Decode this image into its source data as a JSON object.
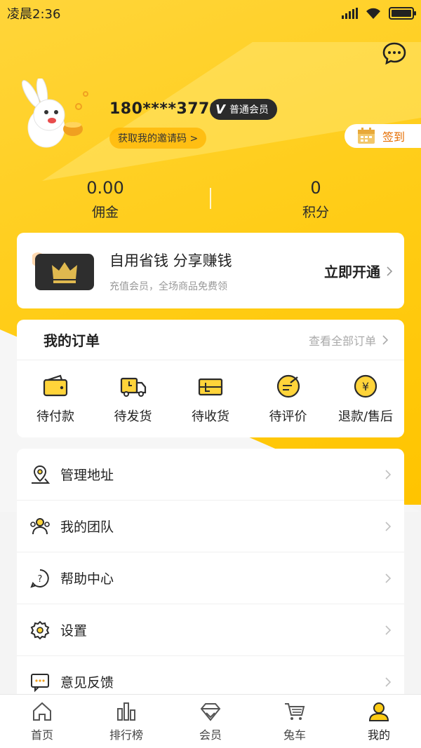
{
  "status_bar": {
    "time": "凌晨2:36"
  },
  "profile": {
    "phone": "180****3779",
    "vip_level": "普通会员",
    "invite_label": "获取我的邀请码 >",
    "signin_label": "签到"
  },
  "stats": [
    {
      "value": "0.00",
      "label": "佣金"
    },
    {
      "value": "0",
      "label": "积分"
    }
  ],
  "vip_promo": {
    "title": "自用省钱 分享赚钱",
    "subtitle": "充值会员，全场商品免费领",
    "action": "立即开通"
  },
  "orders": {
    "title": "我的订单",
    "view_all": "查看全部订单",
    "items": [
      {
        "label": "待付款",
        "icon": "wallet-icon"
      },
      {
        "label": "待发货",
        "icon": "truck-icon"
      },
      {
        "label": "待收货",
        "icon": "package-icon"
      },
      {
        "label": "待评价",
        "icon": "review-icon"
      },
      {
        "label": "退款/售后",
        "icon": "refund-icon"
      }
    ]
  },
  "menu": [
    {
      "label": "管理地址",
      "icon": "location-icon"
    },
    {
      "label": "我的团队",
      "icon": "team-icon"
    },
    {
      "label": "帮助中心",
      "icon": "help-icon"
    },
    {
      "label": "设置",
      "icon": "gear-icon"
    },
    {
      "label": "意见反馈",
      "icon": "feedback-icon"
    }
  ],
  "tabbar": [
    {
      "label": "首页",
      "icon": "home-icon"
    },
    {
      "label": "排行榜",
      "icon": "ranking-icon"
    },
    {
      "label": "会员",
      "icon": "diamond-icon"
    },
    {
      "label": "兔车",
      "icon": "cart-icon"
    },
    {
      "label": "我的",
      "icon": "user-icon",
      "active": true
    }
  ],
  "colors": {
    "primary": "#ffcc14",
    "accent": "#e56d00",
    "dark": "#2b2b2b"
  }
}
